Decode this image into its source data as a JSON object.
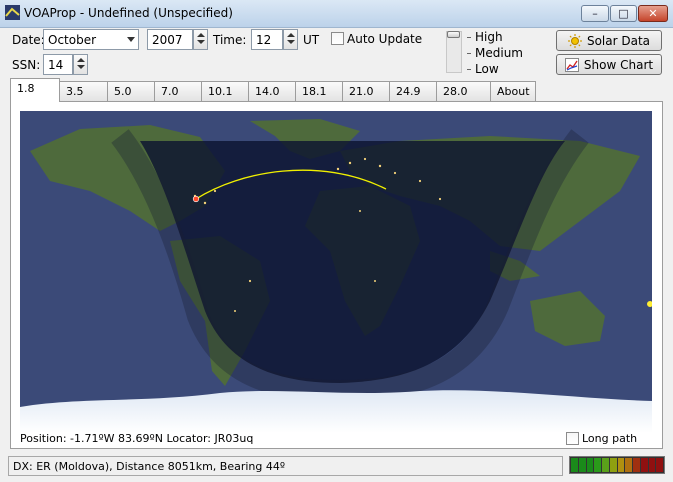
{
  "window": {
    "title": "VOAProp - Undefined (Unspecified)",
    "minimize": "–",
    "maximize": "□",
    "close": "✕"
  },
  "controls": {
    "date_label": "Date:",
    "month": "October",
    "year": "2007",
    "time_label": "Time:",
    "time": "12",
    "time_unit": "UT",
    "auto_update_label": "Auto Update",
    "ssn_label": "SSN:",
    "ssn": "14",
    "level_high": "High",
    "level_medium": "Medium",
    "level_low": "Low",
    "solar_data_button": "Solar Data",
    "show_chart_button": "Show Chart"
  },
  "tabs": [
    {
      "label": "1.8"
    },
    {
      "label": "3.5"
    },
    {
      "label": "5.0"
    },
    {
      "label": "7.0"
    },
    {
      "label": "10.1"
    },
    {
      "label": "14.0"
    },
    {
      "label": "18.1"
    },
    {
      "label": "21.0"
    },
    {
      "label": "24.9"
    },
    {
      "label": "28.0"
    },
    {
      "label": "About"
    }
  ],
  "position_text": "Position: -1.71ºW 83.69ºN  Locator: JR03uq",
  "long_path_label": "Long path",
  "status_text": "DX: ER (Moldova), Distance  8051km, Bearing  44º",
  "colors": {
    "ocean": "#3b4a78",
    "land": "#4e6a3c",
    "night": "#0c1430",
    "path": "#f0f000",
    "meter": [
      "#1a8a1a",
      "#1a8a1a",
      "#1a8a1a",
      "#2a9a1a",
      "#5aa01a",
      "#8fa010",
      "#b09010",
      "#b07010",
      "#a03010",
      "#901010",
      "#901010",
      "#901010"
    ]
  }
}
